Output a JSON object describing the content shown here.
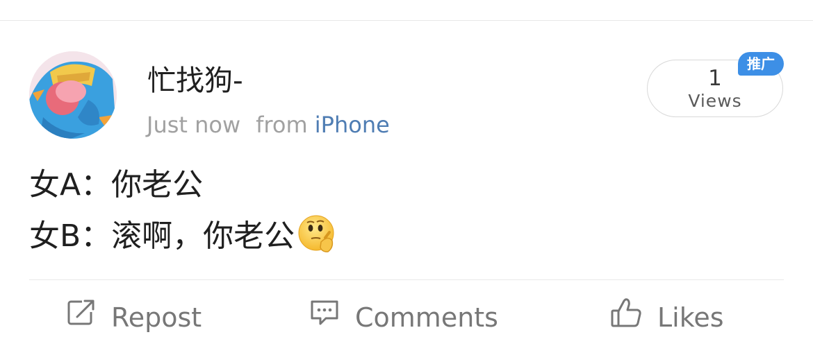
{
  "post": {
    "author": {
      "name": "忙找狗-"
    },
    "timestamp": "Just now",
    "source_prefix": "from",
    "source_device": "iPhone",
    "views": {
      "count": "1",
      "label": "Views"
    },
    "promo_badge": "推广",
    "lines": [
      "女A：你老公",
      "女B：滚啊，你老公"
    ],
    "trailing_emoji": "thinking-face-emoji"
  },
  "actions": {
    "repost": "Repost",
    "comments": "Comments",
    "likes": "Likes"
  },
  "colors": {
    "link_blue": "#4f7db3",
    "badge_blue": "#3d8fe6",
    "meta_gray": "#a1a1a1"
  }
}
